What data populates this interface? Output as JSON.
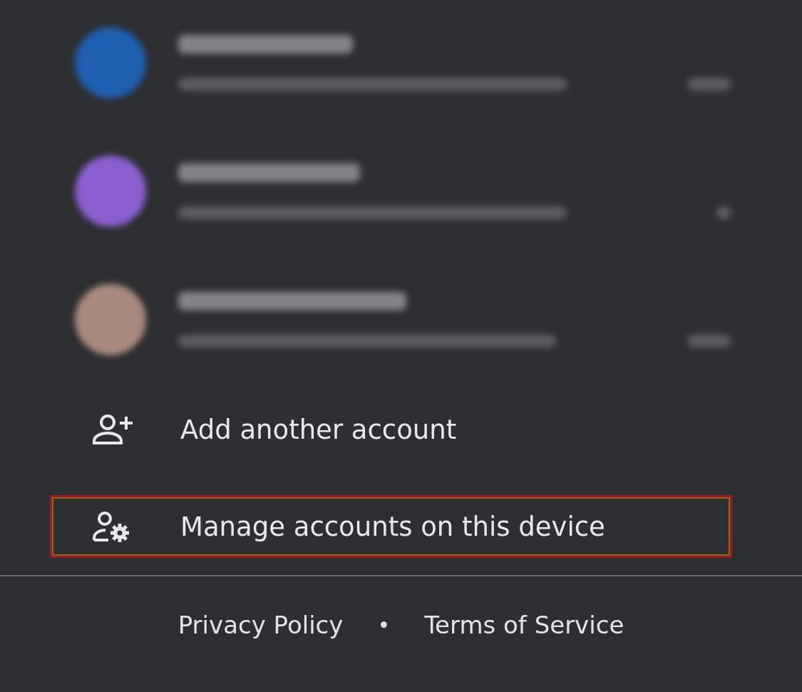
{
  "accounts": [
    {
      "color": "#1f5fb0"
    },
    {
      "color": "#8a5fd0"
    },
    {
      "color": "#a88a7c"
    }
  ],
  "menu": [
    {
      "kind": "add",
      "label": "Add another account",
      "highlighted": false
    },
    {
      "kind": "manage",
      "label": "Manage accounts on this device",
      "highlighted": true
    }
  ],
  "footer": {
    "links": [
      "Privacy Policy",
      "Terms of Service"
    ],
    "separator": "•"
  }
}
